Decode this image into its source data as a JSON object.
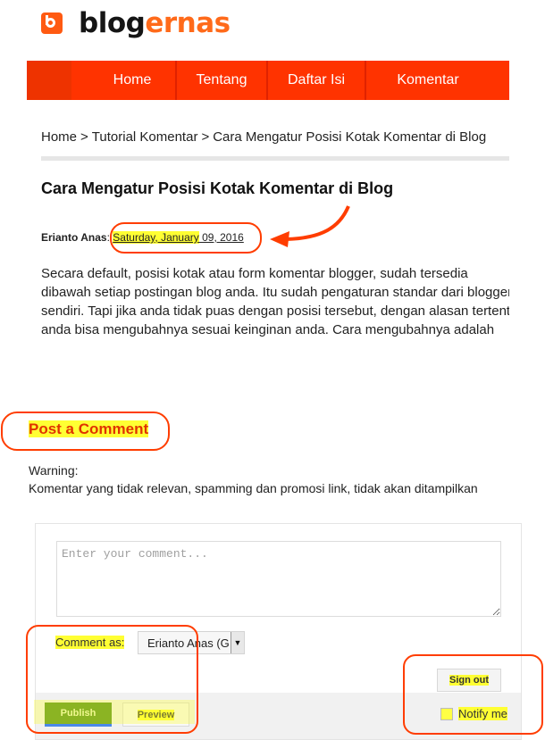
{
  "brand": {
    "name_dark": "blog",
    "name_accent": "ernas",
    "accent_color": "#ff6a1a"
  },
  "nav": {
    "items": [
      {
        "label": "Home"
      },
      {
        "label": "Tentang"
      },
      {
        "label": "Daftar Isi"
      },
      {
        "label": "Komentar"
      }
    ],
    "color": "#ff3300"
  },
  "breadcrumb": {
    "items": [
      "Home",
      "Tutorial Komentar",
      "Cara Mengatur Posisi Kotak Komentar di Blog"
    ],
    "separator": ">"
  },
  "post": {
    "title": "Cara Mengatur Posisi Kotak Komentar di Blog",
    "author": "Erianto Anas",
    "author_sep": ":",
    "date_highlighted": "Saturday, January",
    "date_rest": " 09, 2016",
    "body_lines": [
      "Secara default, posisi kotak atau form komentar blogger, sudah tersedia",
      "dibawah setiap postingan blog anda. Itu sudah pengaturan standar dari blogger",
      "sendiri. Tapi jika anda tidak puas dengan posisi tersebut, dengan alasan tertentu,",
      "anda bisa mengubahnya sesuai keinginan anda. Cara mengubahnya adalah"
    ]
  },
  "comments": {
    "title": "Post a Comment",
    "warning_label": "Warning:",
    "warning_text": "Komentar yang tidak relevan, spamming dan promosi link, tidak akan ditampilkan",
    "form": {
      "placeholder": "Enter your comment...",
      "value": "",
      "comment_as_label": "Comment as:",
      "identity_selected": "Erianto Anas (G",
      "sign_out_label": "Sign out",
      "publish_label": "Publish",
      "preview_label": "Preview",
      "notify_label": "Notify me",
      "notify_checked": false
    }
  },
  "annotations": {
    "highlight_color": "#ffff33",
    "outline_color": "#ff3d00"
  }
}
